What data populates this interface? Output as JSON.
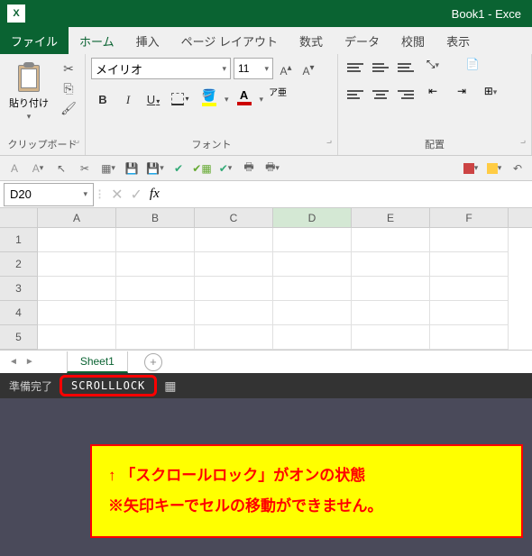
{
  "app": {
    "icon_letter": "X",
    "title": "Book1 - Exce"
  },
  "tabs": {
    "file": "ファイル",
    "home": "ホーム",
    "insert": "挿入",
    "pagelayout": "ページ レイアウト",
    "formulas": "数式",
    "data": "データ",
    "review": "校閲",
    "view": "表示"
  },
  "clipboard": {
    "paste": "貼り付け",
    "label": "クリップボード"
  },
  "font": {
    "name": "メイリオ",
    "size": "11",
    "ruby": "ア亜",
    "label": "フォント"
  },
  "align": {
    "label": "配置"
  },
  "namebox": {
    "ref": "D20"
  },
  "fx": {
    "label": "fx"
  },
  "grid": {
    "cols": [
      "A",
      "B",
      "C",
      "D",
      "E",
      "F"
    ],
    "rows": [
      "1",
      "2",
      "3",
      "4",
      "5"
    ]
  },
  "sheets": {
    "sheet1": "Sheet1"
  },
  "status": {
    "ready": "準備完了",
    "scrolllock": "SCROLLLOCK"
  },
  "callout": {
    "line1": "↑ 「スクロールロック」がオンの状態",
    "line2": "※矢印キーでセルの移動ができません。"
  }
}
